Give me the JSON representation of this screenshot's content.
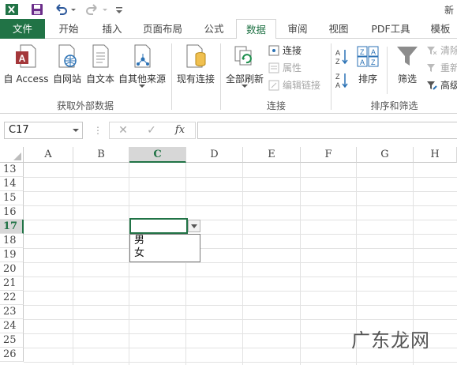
{
  "window": {
    "title_fragment": "新"
  },
  "ribbon_tabs": [
    {
      "id": "file",
      "label": "文件"
    },
    {
      "id": "home",
      "label": "开始"
    },
    {
      "id": "insert",
      "label": "插入"
    },
    {
      "id": "layout",
      "label": "页面布局"
    },
    {
      "id": "formulas",
      "label": "公式"
    },
    {
      "id": "data",
      "label": "数据",
      "active": true
    },
    {
      "id": "review",
      "label": "审阅"
    },
    {
      "id": "view",
      "label": "视图"
    },
    {
      "id": "pdf",
      "label": "PDF工具"
    },
    {
      "id": "template",
      "label": "模板"
    }
  ],
  "ribbon": {
    "get_external": {
      "access": "自 Access",
      "web": "自网站",
      "text": "自文本",
      "other": "自其他来源",
      "group_label": "获取外部数据"
    },
    "existing": "现有连接",
    "connections": {
      "refresh_all": "全部刷新",
      "connect": "连接",
      "properties": "属性",
      "edit_links": "编辑链接",
      "group_label": "连接"
    },
    "sort_filter": {
      "sort": "排序",
      "filter": "筛选",
      "clear": "清除",
      "reapply": "重新",
      "advanced": "高级",
      "group_label": "排序和筛选"
    }
  },
  "formula_bar": {
    "name_box": "C17",
    "cancel": "✕",
    "enter": "✓",
    "fx": "fx",
    "value": ""
  },
  "grid": {
    "columns": [
      "A",
      "B",
      "C",
      "D",
      "E",
      "F",
      "G",
      "H"
    ],
    "selected_column": "C",
    "rows": [
      "13",
      "14",
      "15",
      "16",
      "17",
      "18",
      "19",
      "20",
      "21",
      "22",
      "23",
      "24",
      "25",
      "26"
    ],
    "selected_row": "17",
    "active_cell": "C17"
  },
  "dropdown": {
    "options": [
      "男",
      "女"
    ]
  },
  "watermark": "广东龙网",
  "colors": {
    "accent": "#217346"
  }
}
